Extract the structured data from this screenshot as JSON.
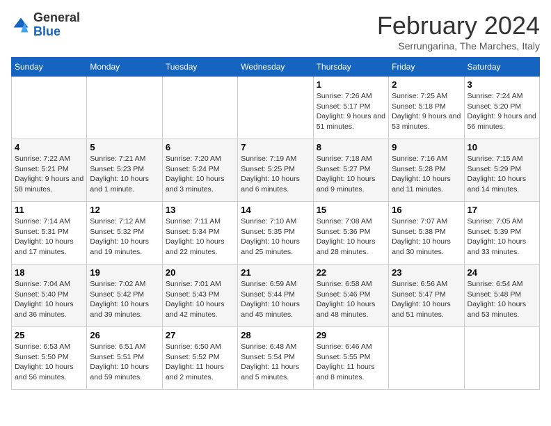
{
  "header": {
    "logo_general": "General",
    "logo_blue": "Blue",
    "month_title": "February 2024",
    "subtitle": "Serrungarina, The Marches, Italy"
  },
  "days_of_week": [
    "Sunday",
    "Monday",
    "Tuesday",
    "Wednesday",
    "Thursday",
    "Friday",
    "Saturday"
  ],
  "weeks": [
    [
      {
        "day": "",
        "info": ""
      },
      {
        "day": "",
        "info": ""
      },
      {
        "day": "",
        "info": ""
      },
      {
        "day": "",
        "info": ""
      },
      {
        "day": "1",
        "info": "Sunrise: 7:26 AM\nSunset: 5:17 PM\nDaylight: 9 hours and 51 minutes."
      },
      {
        "day": "2",
        "info": "Sunrise: 7:25 AM\nSunset: 5:18 PM\nDaylight: 9 hours and 53 minutes."
      },
      {
        "day": "3",
        "info": "Sunrise: 7:24 AM\nSunset: 5:20 PM\nDaylight: 9 hours and 56 minutes."
      }
    ],
    [
      {
        "day": "4",
        "info": "Sunrise: 7:22 AM\nSunset: 5:21 PM\nDaylight: 9 hours and 58 minutes."
      },
      {
        "day": "5",
        "info": "Sunrise: 7:21 AM\nSunset: 5:23 PM\nDaylight: 10 hours and 1 minute."
      },
      {
        "day": "6",
        "info": "Sunrise: 7:20 AM\nSunset: 5:24 PM\nDaylight: 10 hours and 3 minutes."
      },
      {
        "day": "7",
        "info": "Sunrise: 7:19 AM\nSunset: 5:25 PM\nDaylight: 10 hours and 6 minutes."
      },
      {
        "day": "8",
        "info": "Sunrise: 7:18 AM\nSunset: 5:27 PM\nDaylight: 10 hours and 9 minutes."
      },
      {
        "day": "9",
        "info": "Sunrise: 7:16 AM\nSunset: 5:28 PM\nDaylight: 10 hours and 11 minutes."
      },
      {
        "day": "10",
        "info": "Sunrise: 7:15 AM\nSunset: 5:29 PM\nDaylight: 10 hours and 14 minutes."
      }
    ],
    [
      {
        "day": "11",
        "info": "Sunrise: 7:14 AM\nSunset: 5:31 PM\nDaylight: 10 hours and 17 minutes."
      },
      {
        "day": "12",
        "info": "Sunrise: 7:12 AM\nSunset: 5:32 PM\nDaylight: 10 hours and 19 minutes."
      },
      {
        "day": "13",
        "info": "Sunrise: 7:11 AM\nSunset: 5:34 PM\nDaylight: 10 hours and 22 minutes."
      },
      {
        "day": "14",
        "info": "Sunrise: 7:10 AM\nSunset: 5:35 PM\nDaylight: 10 hours and 25 minutes."
      },
      {
        "day": "15",
        "info": "Sunrise: 7:08 AM\nSunset: 5:36 PM\nDaylight: 10 hours and 28 minutes."
      },
      {
        "day": "16",
        "info": "Sunrise: 7:07 AM\nSunset: 5:38 PM\nDaylight: 10 hours and 30 minutes."
      },
      {
        "day": "17",
        "info": "Sunrise: 7:05 AM\nSunset: 5:39 PM\nDaylight: 10 hours and 33 minutes."
      }
    ],
    [
      {
        "day": "18",
        "info": "Sunrise: 7:04 AM\nSunset: 5:40 PM\nDaylight: 10 hours and 36 minutes."
      },
      {
        "day": "19",
        "info": "Sunrise: 7:02 AM\nSunset: 5:42 PM\nDaylight: 10 hours and 39 minutes."
      },
      {
        "day": "20",
        "info": "Sunrise: 7:01 AM\nSunset: 5:43 PM\nDaylight: 10 hours and 42 minutes."
      },
      {
        "day": "21",
        "info": "Sunrise: 6:59 AM\nSunset: 5:44 PM\nDaylight: 10 hours and 45 minutes."
      },
      {
        "day": "22",
        "info": "Sunrise: 6:58 AM\nSunset: 5:46 PM\nDaylight: 10 hours and 48 minutes."
      },
      {
        "day": "23",
        "info": "Sunrise: 6:56 AM\nSunset: 5:47 PM\nDaylight: 10 hours and 51 minutes."
      },
      {
        "day": "24",
        "info": "Sunrise: 6:54 AM\nSunset: 5:48 PM\nDaylight: 10 hours and 53 minutes."
      }
    ],
    [
      {
        "day": "25",
        "info": "Sunrise: 6:53 AM\nSunset: 5:50 PM\nDaylight: 10 hours and 56 minutes."
      },
      {
        "day": "26",
        "info": "Sunrise: 6:51 AM\nSunset: 5:51 PM\nDaylight: 10 hours and 59 minutes."
      },
      {
        "day": "27",
        "info": "Sunrise: 6:50 AM\nSunset: 5:52 PM\nDaylight: 11 hours and 2 minutes."
      },
      {
        "day": "28",
        "info": "Sunrise: 6:48 AM\nSunset: 5:54 PM\nDaylight: 11 hours and 5 minutes."
      },
      {
        "day": "29",
        "info": "Sunrise: 6:46 AM\nSunset: 5:55 PM\nDaylight: 11 hours and 8 minutes."
      },
      {
        "day": "",
        "info": ""
      },
      {
        "day": "",
        "info": ""
      }
    ]
  ]
}
